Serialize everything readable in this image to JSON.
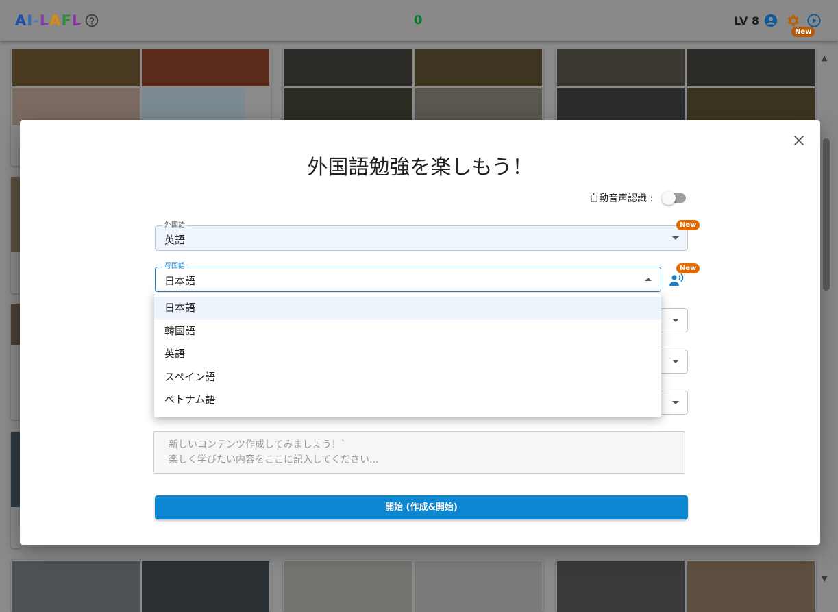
{
  "header": {
    "logo_chars": [
      {
        "char": "A",
        "color": "#1f4ea8"
      },
      {
        "char": "I",
        "color": "#2b6bc4"
      },
      {
        "char": "-",
        "color": "#4a7bd0"
      },
      {
        "char": "L",
        "color": "#7a3ea6"
      },
      {
        "char": "A",
        "color": "#e08a0a"
      },
      {
        "char": "F",
        "color": "#2e8b3c"
      },
      {
        "char": "L",
        "color": "#8b2fb0"
      }
    ],
    "help_icon": "help-circle-icon",
    "score": "0",
    "level": "LV 8",
    "account_icon": "account-circle-icon",
    "settings_icon": "gear-icon",
    "settings_badge": "New",
    "play_icon": "play-circle-icon"
  },
  "modal": {
    "title": "外国語勉強を楽しもう！",
    "close_icon": "close-icon",
    "auto_voice_label": "自動音声認識 :",
    "auto_voice_on": false,
    "foreign_field": {
      "label": "外国語",
      "value": "英語",
      "badge": "New"
    },
    "native_field": {
      "label": "母国語",
      "value": "日本語",
      "badge": "New",
      "voice_icon": "voice-person-icon"
    },
    "native_options": [
      "日本語",
      "韓国語",
      "英語",
      "スペイン語",
      "ベトナム語"
    ],
    "native_selected_index": 0,
    "textarea_placeholder": "新しいコンテンツ作成してみましょう！`\n楽しく学びたい内容をここに記入してください...",
    "start_button": "開始 (作成&開始)"
  },
  "colors": {
    "accent": "#0c86d0",
    "badge": "#e06a00",
    "score": "#0c7a2c",
    "selected_option": "#eef4fb"
  }
}
